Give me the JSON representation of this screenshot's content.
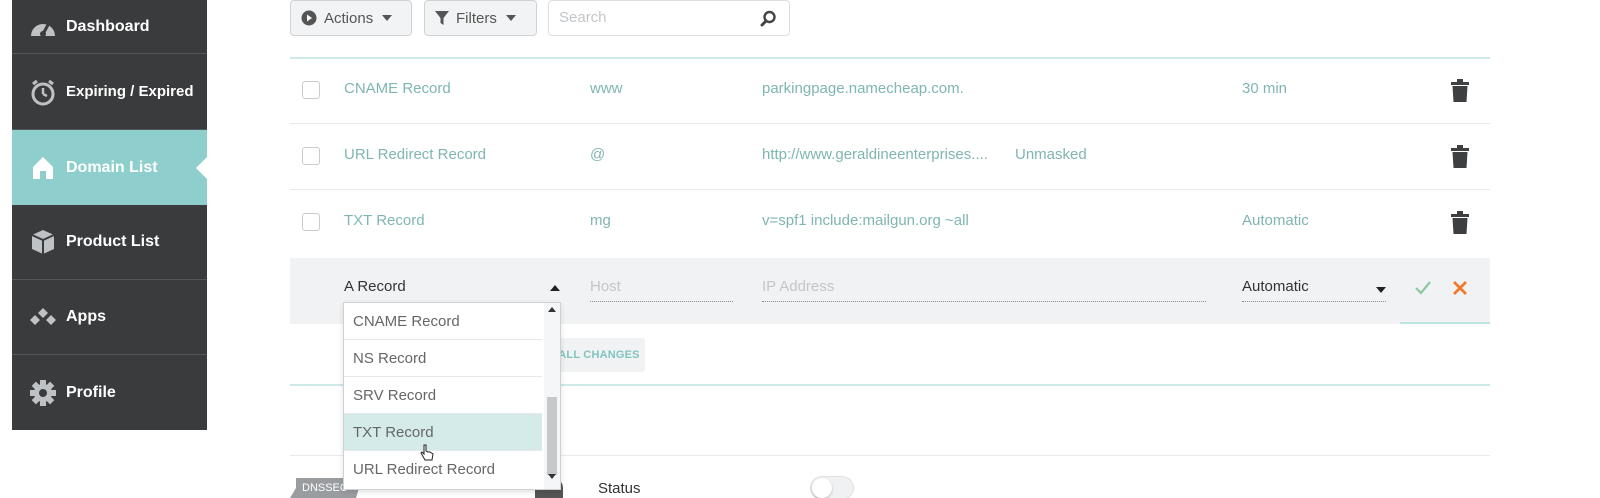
{
  "sidebar": {
    "items": [
      {
        "label": "Dashboard",
        "icon": "dashboard-gauge-icon"
      },
      {
        "label": "Expiring / Expired",
        "icon": "stopwatch-icon"
      },
      {
        "label": "Domain List",
        "icon": "home-icon",
        "active": true
      },
      {
        "label": "Product List",
        "icon": "box-icon"
      },
      {
        "label": "Apps",
        "icon": "apps-diamonds-icon"
      },
      {
        "label": "Profile",
        "icon": "gear-icon"
      }
    ]
  },
  "toolbar": {
    "actions_label": "Actions",
    "filters_label": "Filters",
    "search_placeholder": "Search"
  },
  "records": [
    {
      "type": "CNAME Record",
      "host": "www",
      "value": "parkingpage.namecheap.com.",
      "extra": "",
      "ttl": "30 min"
    },
    {
      "type": "URL Redirect Record",
      "host": "@",
      "value": "http://www.geraldineenterprises....",
      "extra": "Unmasked",
      "ttl": ""
    },
    {
      "type": "TXT Record",
      "host": "mg",
      "value": "v=spf1 include:mailgun.org ~all",
      "extra": "",
      "ttl": "Automatic"
    }
  ],
  "new_record": {
    "type_value": "A Record",
    "host_placeholder": "Host",
    "ip_placeholder": "IP Address",
    "ttl_value": "Automatic"
  },
  "save_all_label": "ALL CHANGES",
  "type_dropdown": {
    "options": [
      "CNAME Record",
      "NS Record",
      "SRV Record",
      "TXT Record",
      "URL Redirect Record"
    ],
    "highlighted": "TXT Record"
  },
  "dnssec": {
    "badge": "DNSSEC",
    "status_label": "Status",
    "enabled": false
  },
  "colors": {
    "sidebar_bg": "#3a3b3d",
    "active_nav": "#8ecfcd",
    "record_text": "#7fb5b2",
    "confirm_green": "#8cc9a0",
    "cancel_orange": "#f07a2a"
  }
}
